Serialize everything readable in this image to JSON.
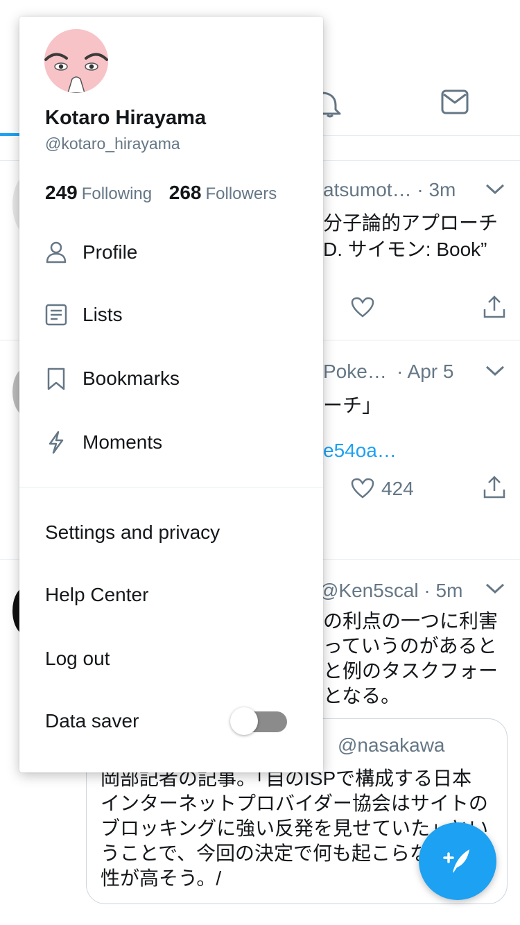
{
  "profile": {
    "name": "Kotaro Hirayama",
    "handle": "@kotaro_hirayama",
    "following_count": "249",
    "following_label": "Following",
    "followers_count": "268",
    "followers_label": "Followers"
  },
  "menu": {
    "primary": [
      {
        "label": "Profile",
        "icon": "person-icon"
      },
      {
        "label": "Lists",
        "icon": "list-icon"
      },
      {
        "label": "Bookmarks",
        "icon": "bookmark-icon"
      },
      {
        "label": "Moments",
        "icon": "lightning-icon"
      }
    ],
    "secondary": [
      {
        "label": "Settings and privacy"
      },
      {
        "label": "Help Center"
      },
      {
        "label": "Log out"
      }
    ],
    "data_saver": {
      "label": "Data saver",
      "enabled": false
    }
  },
  "timeline": {
    "tweet1": {
      "meta": "atsumot… · 3m",
      "line1": "分子論的アプローチ",
      "line2": "D. サイモン: Book”"
    },
    "tweet2": {
      "meta": "Poke…",
      "time": "· Apr 5",
      "line1": "ーチ」",
      "link": "e54oa…",
      "likes": "424"
    },
    "tweet3": {
      "meta": "@Ken5scal · 5m",
      "line1": "の利点の一つに利害",
      "line2": "っていうのがあると",
      "line3": "と例のタスクフォー",
      "line4": "となる。",
      "quote": {
        "handle": "@nasakawa",
        "line1": "岡部記者の記事。「自のISPで構成する日本",
        "line2": "インターネットプロバイダー協会はサイトの",
        "line3": "ブロッキングに強い反発を見せていた」とい",
        "line4": "うことで、今回の決定で何も起こらな",
        "line5": "性が高そう。/"
      }
    }
  },
  "colors": {
    "accent": "#1da1f2",
    "text": "#14171a",
    "muted": "#657786",
    "divider": "#e6ecf0",
    "avatar_bg": "#f7c3c6"
  }
}
